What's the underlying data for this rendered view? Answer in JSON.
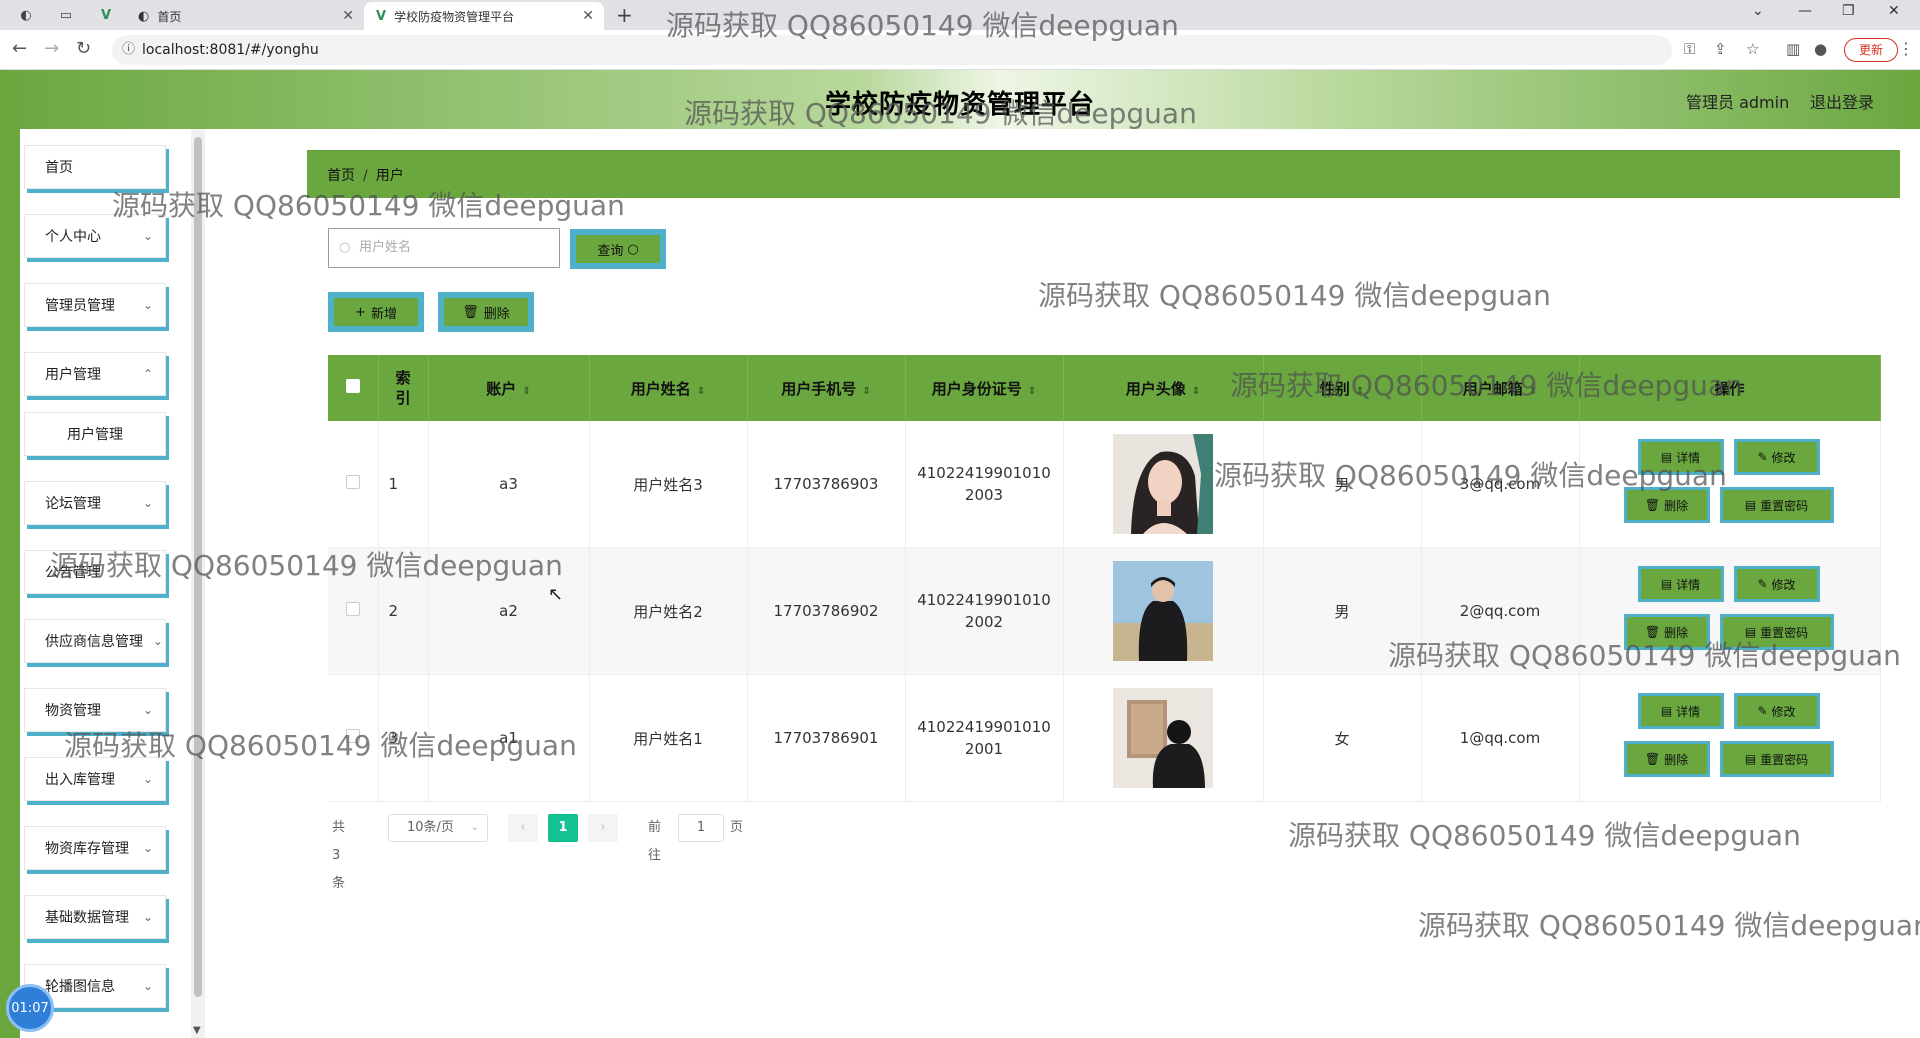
{
  "browser": {
    "tabs": [
      {
        "label": "首页",
        "icon": "globe-icon"
      },
      {
        "label": "学校防疫物资管理平台",
        "icon": "vue-icon"
      }
    ],
    "url": "localhost:8081/#/yonghu",
    "update_label": "更新"
  },
  "header": {
    "title": "学校防疫物资管理平台",
    "admin_label": "管理员 admin",
    "logout_label": "退出登录"
  },
  "sidebar": {
    "items": [
      {
        "label": "首页"
      },
      {
        "label": "个人中心"
      },
      {
        "label": "管理员管理"
      },
      {
        "label": "用户管理"
      },
      {
        "label": "用户管理"
      },
      {
        "label": "论坛管理"
      },
      {
        "label": "公告管理"
      },
      {
        "label": "供应商信息管理"
      },
      {
        "label": "物资管理"
      },
      {
        "label": "出入库管理"
      },
      {
        "label": "物资库存管理"
      },
      {
        "label": "基础数据管理"
      },
      {
        "label": "轮播图信息"
      }
    ],
    "timer": "01:07"
  },
  "breadcrumb": {
    "home": "首页",
    "separator": "/",
    "current": "用户"
  },
  "search": {
    "placeholder": "用户姓名",
    "query_label": "查询"
  },
  "toolbar": {
    "add_label": "新增",
    "delete_label": "删除"
  },
  "table": {
    "headers": [
      "索引",
      "账户",
      "用户姓名",
      "用户手机号",
      "用户身份证号",
      "用户头像",
      "性别",
      "用户邮箱",
      "操作"
    ],
    "rows": [
      {
        "index": "1",
        "account": "a3",
        "name": "用户姓名3",
        "phone": "17703786903",
        "id_card": "41022419901010 2003",
        "gender": "男",
        "email": "3@qq.com"
      },
      {
        "index": "2",
        "account": "a2",
        "name": "用户姓名2",
        "phone": "17703786902",
        "id_card": "41022419901010 2002",
        "gender": "男",
        "email": "2@qq.com"
      },
      {
        "index": "3",
        "account": "a1",
        "name": "用户姓名1",
        "phone": "17703786901",
        "id_card": "41022419901010 2001",
        "gender": "女",
        "email": "1@qq.com"
      }
    ],
    "actions": {
      "detail": "详情",
      "edit": "修改",
      "delete": "删除",
      "reset": "重置密码"
    }
  },
  "pagination": {
    "total": "共 3 条",
    "page_size": "10条/页",
    "current_page": "1",
    "goto_label": "前往",
    "goto_value": "1",
    "page_suffix": "页"
  },
  "watermark": "源码获取 QQ86050149 微信deepguan",
  "colors": {
    "primary_green": "#6aa73f",
    "accent_cyan": "#4fb1c9",
    "page_active": "#13c290"
  }
}
